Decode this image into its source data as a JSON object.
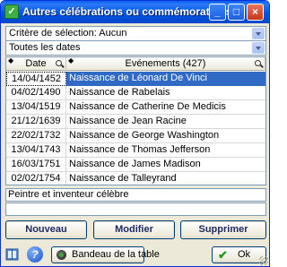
{
  "window": {
    "title": "Autres célébrations ou commémorations",
    "title_icon": "calendar-app-icon",
    "controls": [
      "minimize",
      "maximize",
      "close"
    ]
  },
  "filters": {
    "criteria": "Critère de sélection: Aucun",
    "dates": "Toutes les dates"
  },
  "table": {
    "columns": {
      "date": "Date",
      "event": "Evénements (427)"
    },
    "rows": [
      {
        "date": "14/04/1452",
        "event": "Naissance de Léonard De Vinci",
        "selected": true
      },
      {
        "date": "04/02/1490",
        "event": "Naissance de Rabelais"
      },
      {
        "date": "13/04/1519",
        "event": "Naissance de Catherine De Medicis"
      },
      {
        "date": "21/12/1639",
        "event": "Naissance de Jean Racine"
      },
      {
        "date": "22/02/1732",
        "event": "Naissance de George Washington"
      },
      {
        "date": "13/04/1743",
        "event": "Naissance de Thomas Jefferson"
      },
      {
        "date": "16/03/1751",
        "event": "Naissance de James Madison"
      },
      {
        "date": "02/02/1754",
        "event": "Naissance de Talleyrand"
      }
    ],
    "selection_color": "#316ac5"
  },
  "details": {
    "description": "Peintre et inventeur célèbre",
    "extra": ""
  },
  "buttons": {
    "new": "Nouveau",
    "modify": "Modifier",
    "delete": "Supprimer",
    "banner": "Bandeau de la table",
    "ok": "Ok"
  },
  "icons": {
    "book": "book-icon",
    "help": "help-icon",
    "banner": "banner-icon",
    "ok": "check-icon"
  }
}
